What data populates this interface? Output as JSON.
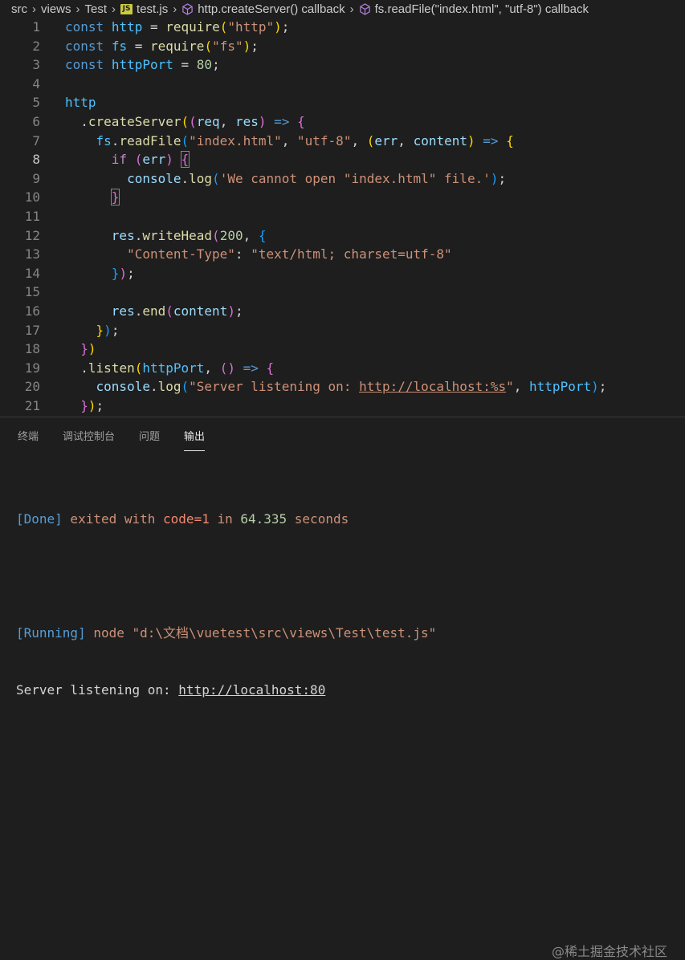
{
  "breadcrumb": {
    "items": [
      "src",
      "views",
      "Test",
      "test.js",
      "http.createServer() callback",
      "fs.readFile(\"index.html\", \"utf-8\") callback"
    ],
    "js_badge": "JS"
  },
  "editor": {
    "line_numbers": [
      "1",
      "2",
      "3",
      "4",
      "5",
      "6",
      "7",
      "8",
      "9",
      "10",
      "11",
      "12",
      "13",
      "14",
      "15",
      "16",
      "17",
      "18",
      "19",
      "20",
      "21"
    ],
    "active_line": "8"
  },
  "panel": {
    "tabs": [
      "终端",
      "调试控制台",
      "问题",
      "输出"
    ],
    "active_tab": "输出",
    "output": {
      "done_tag": "[Done]",
      "done_text_1": " exited with ",
      "done_code": "code=1",
      "done_text_2": " in ",
      "done_seconds": "64.335",
      "done_text_3": " seconds",
      "running_tag": "[Running]",
      "running_cmd": " node \"d:\\文档\\vuetest\\src\\views\\Test\\test.js\"",
      "server_prefix": "Server listening on: ",
      "server_url": "http://localhost:80"
    }
  },
  "watermark": "@稀土掘金技术社区",
  "colors": {
    "keyword": "#569cd6",
    "variable": "#4fc1ff",
    "function": "#dcdcaa",
    "string": "#ce9178",
    "number": "#b5cea8",
    "param": "#9cdcfe"
  }
}
